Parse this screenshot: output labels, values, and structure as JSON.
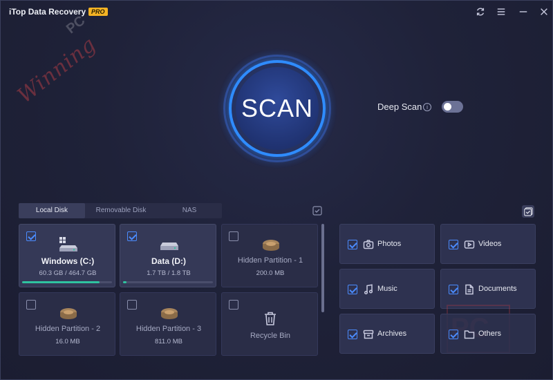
{
  "titlebar": {
    "app_title": "iTop Data Recovery",
    "badge": "PRO",
    "icons": [
      "refresh-icon",
      "menu-icon",
      "minimize-icon",
      "close-icon"
    ]
  },
  "watermark": {
    "text": "Winning",
    "suffix": "PC"
  },
  "scan": {
    "label": "SCAN",
    "accent": "#2f8cff"
  },
  "deep_scan": {
    "label": "Deep Scan",
    "info_glyph": "i",
    "enabled": false
  },
  "tabs": [
    {
      "label": "Local Disk",
      "active": true
    },
    {
      "label": "Removable Disk",
      "active": false
    },
    {
      "label": "NAS",
      "active": false
    }
  ],
  "disks": [
    {
      "name": "Windows (C:)",
      "size": "60.3 GB / 464.7 GB",
      "checked": true,
      "usage_fraction": 0.13,
      "icon": "windows-drive-icon"
    },
    {
      "name": "Data (D:)",
      "size": "1.7 TB / 1.8 TB",
      "checked": true,
      "usage_fraction": 0.04,
      "icon": "drive-icon"
    },
    {
      "name": "Hidden Partition - 1",
      "size": "200.0 MB",
      "checked": false,
      "icon": "hidden-drive-icon"
    },
    {
      "name": "Hidden Partition - 2",
      "size": "16.0 MB",
      "checked": false,
      "icon": "hidden-drive-icon"
    },
    {
      "name": "Hidden Partition - 3",
      "size": "811.0 MB",
      "checked": false,
      "icon": "hidden-drive-icon"
    },
    {
      "name": "Recycle Bin",
      "size": "",
      "checked": false,
      "icon": "trash-icon"
    }
  ],
  "file_types": [
    {
      "label": "Photos",
      "icon": "camera-icon",
      "checked": true
    },
    {
      "label": "Videos",
      "icon": "play-icon",
      "checked": true
    },
    {
      "label": "Music",
      "icon": "music-note-icon",
      "checked": true
    },
    {
      "label": "Documents",
      "icon": "document-icon",
      "checked": true
    },
    {
      "label": "Archives",
      "icon": "archive-icon",
      "checked": true
    },
    {
      "label": "Others",
      "icon": "folder-icon",
      "checked": true
    }
  ],
  "colors": {
    "usage_bar": "#2fc3a0",
    "checkbox": "#4b8cff",
    "pro_badge": "#f4b324"
  }
}
